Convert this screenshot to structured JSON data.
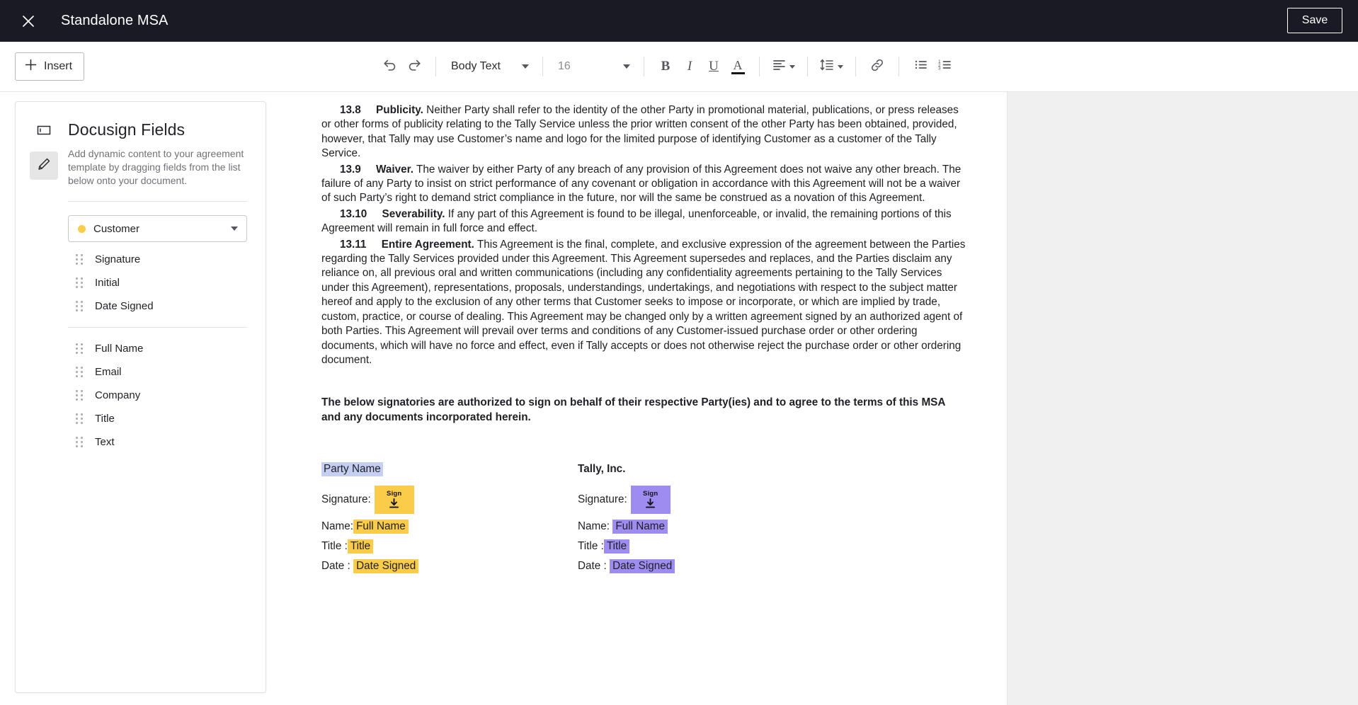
{
  "window": {
    "title": "Standalone MSA",
    "close_icon": "close-icon",
    "save_label": "Save"
  },
  "toolbar": {
    "insert_label": "Insert",
    "insert_icon": "plus-icon",
    "undo_icon": "undo-icon",
    "redo_icon": "redo-icon",
    "paragraph_style": "Body Text",
    "font_size": "16",
    "bold_label": "B",
    "italic_label": "I",
    "underline_label": "U",
    "text_color_label": "A",
    "align_icon": "align-left-icon",
    "line_spacing_icon": "line-spacing-icon",
    "link_icon": "link-icon",
    "bullet_list_icon": "bulleted-list-icon",
    "numbered_list_icon": "numbered-list-icon"
  },
  "sidebar": {
    "icons": [
      {
        "name": "text-field-icon",
        "active": false
      },
      {
        "name": "signature-pen-icon",
        "active": true
      }
    ],
    "title": "Docusign Fields",
    "description": "Add dynamic content to your agreement template by dragging fields from the list below onto your document.",
    "recipient": {
      "label": "Customer",
      "color": "#fbcb4a",
      "chevron_icon": "chevron-down-icon"
    },
    "signature_fields": [
      {
        "label": "Signature"
      },
      {
        "label": "Initial"
      },
      {
        "label": "Date Signed"
      }
    ],
    "data_fields": [
      {
        "label": "Full Name"
      },
      {
        "label": "Email"
      },
      {
        "label": "Company"
      },
      {
        "label": "Title"
      },
      {
        "label": "Text"
      }
    ]
  },
  "document": {
    "paragraphs": [
      {
        "number": "13.8",
        "title": "Publicity.",
        "text": " Neither Party shall refer to the identity of the other Party in promotional material, publications, or press releases or other forms of publicity relating to the Tally Service unless the prior written consent of the other Party has been obtained, provided, however, that Tally may use Customer’s name and logo for the limited purpose of identifying Customer as a customer of the Tally Service."
      },
      {
        "number": "13.9",
        "title": "Waiver.",
        "text": " The waiver by either Party of any breach of any provision of this Agreement does not waive any other breach. The failure of any Party to insist on strict performance of any covenant or obligation in accordance with this Agreement will not be a waiver of such Party’s right to demand strict compliance in the future, nor will the same be construed as a novation of this Agreement."
      },
      {
        "number": "13.10",
        "title": "Severability.",
        "text": " If any part of this Agreement is found to be illegal, unenforceable, or invalid, the remaining portions of this Agreement will remain in full force and effect."
      },
      {
        "number": "13.11",
        "title": "Entire Agreement.",
        "text": " This Agreement is the final, complete, and exclusive expression of the agreement between the Parties regarding the Tally Services provided under this Agreement. This Agreement supersedes and replaces, and the Parties disclaim any reliance on, all previous oral and written communications (including any confidentiality agreements pertaining to the Tally Services under this Agreement), representations, proposals, understandings, undertakings, and negotiations with respect to the subject matter hereof and apply to the exclusion of any other terms that Customer seeks to impose or incorporate, or which are implied by trade, custom, practice, or course of dealing. This Agreement may be changed only by a written agreement signed by an authorized agent of both Parties. This Agreement will prevail over terms and conditions of any Customer-issued purchase order or other ordering documents, which will have no force and effect, even if Tally accepts or does not otherwise reject the purchase order or other ordering document."
      }
    ],
    "signatories_intro": "The below signatories are authorized to sign on behalf of their respective Party(ies) and to agree to the terms of this MSA and any documents incorporated herein.",
    "signature_blocks": [
      {
        "party_name": "Party Name",
        "party_is_field": true,
        "field_color": "#fbcb4a",
        "party_chip_color": "#c4cff1",
        "sign_tag_label": "Sign",
        "rows": [
          {
            "label": "Signature:",
            "value": "",
            "type": "sign"
          },
          {
            "label": "Name:",
            "value": "Full Name",
            "type": "field"
          },
          {
            "label": "Title :",
            "value": "Title",
            "type": "field"
          },
          {
            "label": "Date :",
            "value": "Date Signed",
            "type": "field"
          }
        ]
      },
      {
        "party_name": "Tally, Inc.",
        "party_is_field": false,
        "field_color": "#9e8cf0",
        "sign_tag_label": "Sign",
        "rows": [
          {
            "label": "Signature:",
            "value": "",
            "type": "sign"
          },
          {
            "label": "Name:",
            "value": "Full Name",
            "type": "field"
          },
          {
            "label": "Title :",
            "value": "Title",
            "type": "field"
          },
          {
            "label": "Date :",
            "value": "Date Signed",
            "type": "field"
          }
        ]
      }
    ]
  }
}
